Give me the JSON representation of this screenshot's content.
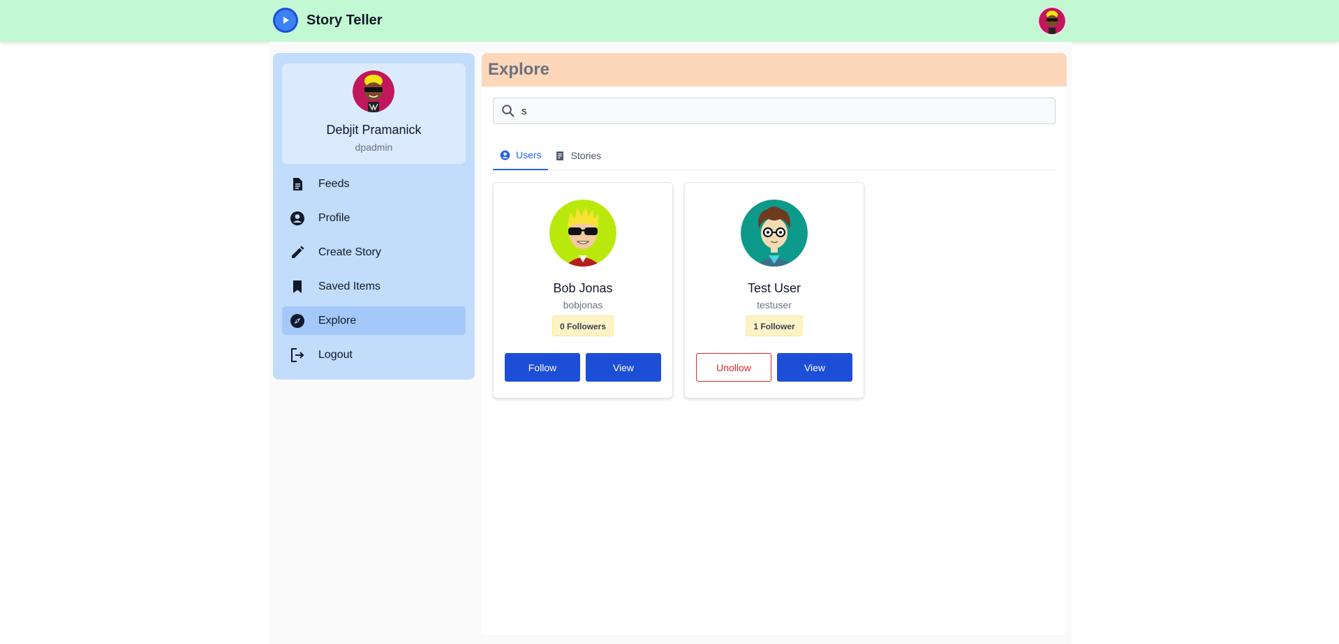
{
  "app": {
    "title": "Story Teller",
    "logo_icon": "play-circle-icon",
    "accent": "#2563eb",
    "topbar_color": "#c2f8d4"
  },
  "current_user": {
    "name": "Debjit Pramanick",
    "username": "dpadmin"
  },
  "sidebar": {
    "items": [
      {
        "label": "Feeds",
        "icon": "document-icon"
      },
      {
        "label": "Profile",
        "icon": "user-circle-icon"
      },
      {
        "label": "Create Story",
        "icon": "pencil-icon"
      },
      {
        "label": "Saved Items",
        "icon": "bookmark-icon"
      },
      {
        "label": "Explore",
        "icon": "compass-icon",
        "active": true
      },
      {
        "label": "Logout",
        "icon": "logout-icon"
      }
    ]
  },
  "main": {
    "title": "Explore",
    "search": {
      "value": "s",
      "icon": "search-icon"
    },
    "tabs": [
      {
        "label": "Users",
        "icon": "user-circle-icon",
        "active": true
      },
      {
        "label": "Stories",
        "icon": "document-icon"
      }
    ],
    "cards": [
      {
        "name": "Bob Jonas",
        "username": "bobjonas",
        "followers": "0 Followers",
        "primary_action": "Follow",
        "secondary_action": "View"
      },
      {
        "name": "Test User",
        "username": "testuser",
        "followers": "1 Follower",
        "primary_action": "Unollow",
        "secondary_action": "View"
      }
    ]
  }
}
